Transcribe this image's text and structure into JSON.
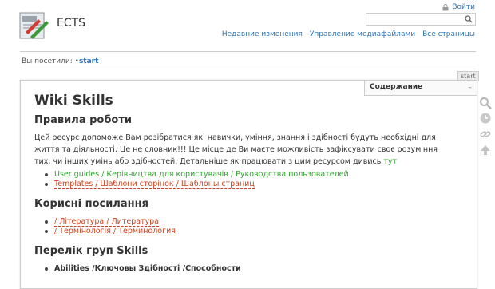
{
  "header": {
    "site_title": "ECTS",
    "login_label": "Войти",
    "search": {
      "value": "",
      "placeholder": ""
    },
    "usertools": [
      "Недавние изменения",
      "Управление медиафайлами",
      "Все страницы"
    ]
  },
  "breadcrumbs": {
    "label": "Вы посетили:",
    "current": "start",
    "separator": "•"
  },
  "page": {
    "tab": "start",
    "toc_label": "Содержание",
    "toc_toggle": "–",
    "title": "Wiki Skills",
    "sections": [
      {
        "heading": "Правила роботи"
      },
      {
        "heading": "Корисні посилання"
      },
      {
        "heading": "Перелік груп Skills"
      }
    ],
    "intro_lines": [
      "Цей ресурс допоможе Вам розібратися які навички, уміння, знання і здібності будуть необхідні для життя та діяльності. Це не",
      "словник!!! Це місце де Ви маєте можливість зафіксувати своє розуміння тих, чи інших умінь або здібностей. Детальніше як",
      "працювати з цим ресурсом дивись"
    ],
    "intro_link": "тут",
    "rules_links": [
      {
        "text": "User guides / Керівництва для користувачів / Руководства пользователей",
        "status": "exists"
      },
      {
        "text": "Templates / Шаблони сторінок / Шаблоны страниц",
        "status": "missing"
      }
    ],
    "useful_links": [
      {
        "text": "/ Література / Литература",
        "status": "missing"
      },
      {
        "text": "/ Термінологія / Терминология",
        "status": "missing"
      }
    ],
    "skills_groups": [
      {
        "text": "Abilities /Ключовы Здібності /Способности"
      }
    ]
  },
  "colors": {
    "link": "#2b73b7",
    "existing_link": "#2fa52f",
    "missing_link": "#d1421e"
  },
  "sidebar_tools": [
    "search-icon",
    "revisions-icon",
    "backlinks-icon",
    "back-to-top-icon"
  ]
}
